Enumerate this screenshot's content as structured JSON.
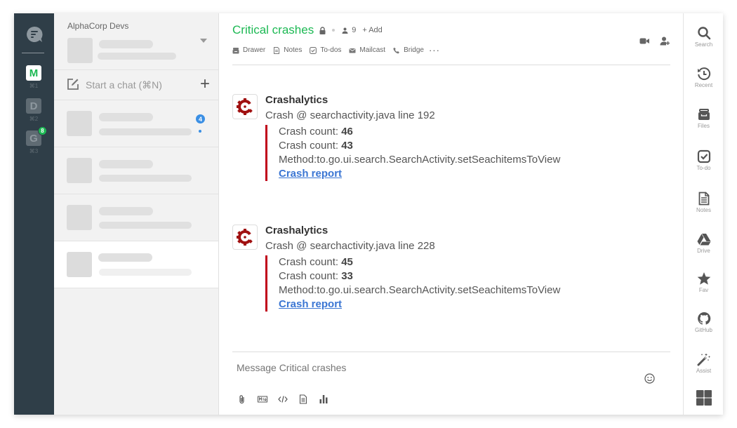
{
  "orgs": [
    {
      "letter": "M",
      "shortcut": "⌘1",
      "active": true
    },
    {
      "letter": "D",
      "shortcut": "⌘2",
      "active": false
    },
    {
      "letter": "G",
      "shortcut": "⌘3",
      "active": false,
      "badge": "8"
    }
  ],
  "sidebar": {
    "org_name": "AlphaCorp Devs",
    "start_chat_label": "Start a chat (⌘N)",
    "chat_items": [
      {
        "unread": "4"
      },
      {},
      {},
      {
        "selected": true
      }
    ]
  },
  "channel": {
    "title": "Critical crashes",
    "member_count": "9",
    "add_label": "+ Add",
    "tabs": [
      {
        "label": "Drawer",
        "icon": "drawer-icon"
      },
      {
        "label": "Notes",
        "icon": "notes-icon"
      },
      {
        "label": "To-dos",
        "icon": "todo-icon"
      },
      {
        "label": "Mailcast",
        "icon": "mail-icon"
      },
      {
        "label": "Bridge",
        "icon": "phone-icon"
      }
    ],
    "more_label": "···"
  },
  "messages": [
    {
      "sender": "Crashalytics",
      "text": "Crash @ searchactivity.java line 192",
      "count_label": "Crash count: ",
      "count1": "46",
      "count2": "43",
      "method": "Method:to.go.ui.search.SearchActivity.setSeachitemsToView",
      "link": "Crash report"
    },
    {
      "sender": "Crashalytics",
      "text": "Crash @ searchactivity.java line 228",
      "count_label": "Crash count: ",
      "count1": "45",
      "count2": "33",
      "method": "Method:to.go.ui.search.SearchActivity.setSeachitemsToView",
      "link": "Crash report"
    }
  ],
  "composer": {
    "placeholder": "Message Critical crashes"
  },
  "apps": [
    {
      "label": "Search",
      "icon": "search-icon"
    },
    {
      "label": "Recent",
      "icon": "history-icon"
    },
    {
      "label": "Files",
      "icon": "files-icon"
    },
    {
      "label": "To-do",
      "icon": "todo-icon"
    },
    {
      "label": "Notes",
      "icon": "notes-icon"
    },
    {
      "label": "Drive",
      "icon": "drive-icon"
    },
    {
      "label": "Fav",
      "icon": "star-icon"
    },
    {
      "label": "GitHub",
      "icon": "github-icon"
    },
    {
      "label": "Assist",
      "icon": "magic-wand-icon"
    }
  ],
  "colors": {
    "accent": "#1db954",
    "rail": "#2f3e48",
    "attachment_bar": "#c0001a",
    "link": "#3b76d3",
    "unread_badge": "#3b8fe4",
    "crashalytics_brand": "#a01010"
  }
}
